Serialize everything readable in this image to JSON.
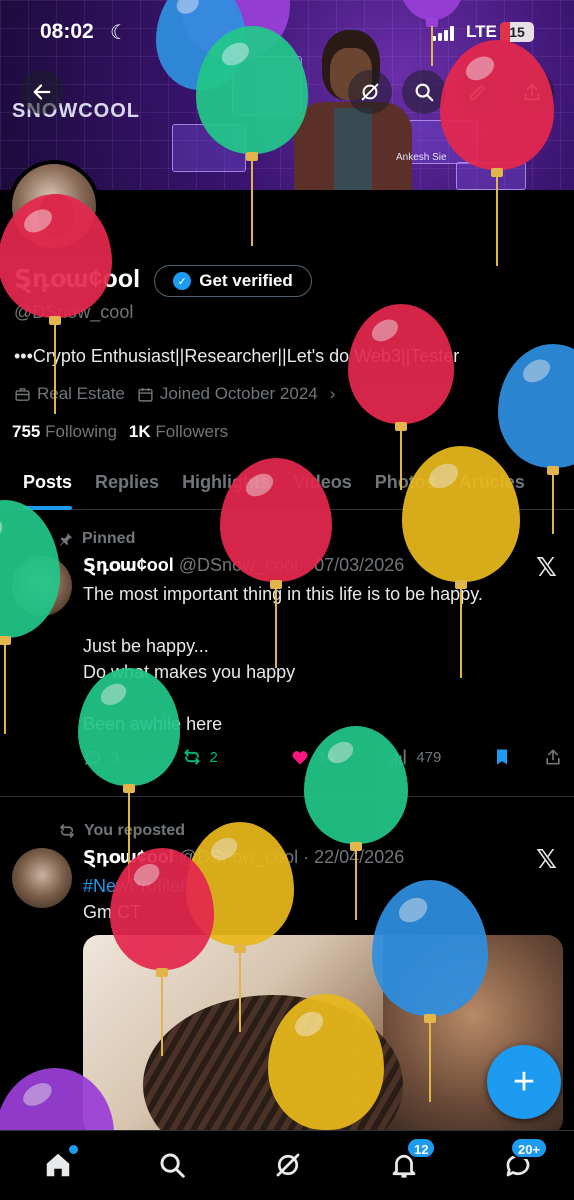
{
  "status_bar": {
    "time": "08:02",
    "network": "LTE",
    "battery": "15"
  },
  "banner": {
    "brand": "SNOWCOOL",
    "holo_label": "Ankesh Sie"
  },
  "header_icons": [
    "back-arrow-icon",
    "grok-icon",
    "search-icon",
    "edit-icon",
    "share-icon"
  ],
  "profile": {
    "name": "Ȿդօա¢ool",
    "verify_label": "Get verified",
    "handle": "@DSnow_cool",
    "bio": "•••Crypto Enthusiast||Researcher||Let's do Web3||Tester",
    "category": "Real Estate",
    "joined": "Joined October 2024",
    "following_count": "755",
    "following_label": "Following",
    "followers_count": "1K",
    "followers_label": "Followers"
  },
  "tabs": [
    "Posts",
    "Replies",
    "Highlights",
    "Videos",
    "Photos",
    "Articles"
  ],
  "posts": [
    {
      "context": "Pinned",
      "name": "Ȿդօա¢ool",
      "handle": "@DSnow_cool",
      "date": "· 07/03/2026",
      "lines": [
        "The most important thing in this life is to be happy.",
        "",
        "Just be happy...",
        "Do what makes you happy",
        "",
        "Been awhile here"
      ],
      "replies": "3",
      "reposts": "2",
      "likes": "14",
      "views": "479"
    },
    {
      "context": "You reposted",
      "name": "Ȿդօա¢ool",
      "handle": "@DSnow_cool",
      "date": "· 22/04/2026",
      "hashtag": "#NewProfilePic",
      "text": "Gm CT"
    }
  ],
  "fab_label": "+",
  "nav": {
    "notifications_badge": "12",
    "messages_badge": "20+"
  },
  "colors": {
    "accent": "#1d9bf0",
    "like": "#f91880",
    "repost": "#00ba7c",
    "muted": "#71767b"
  }
}
